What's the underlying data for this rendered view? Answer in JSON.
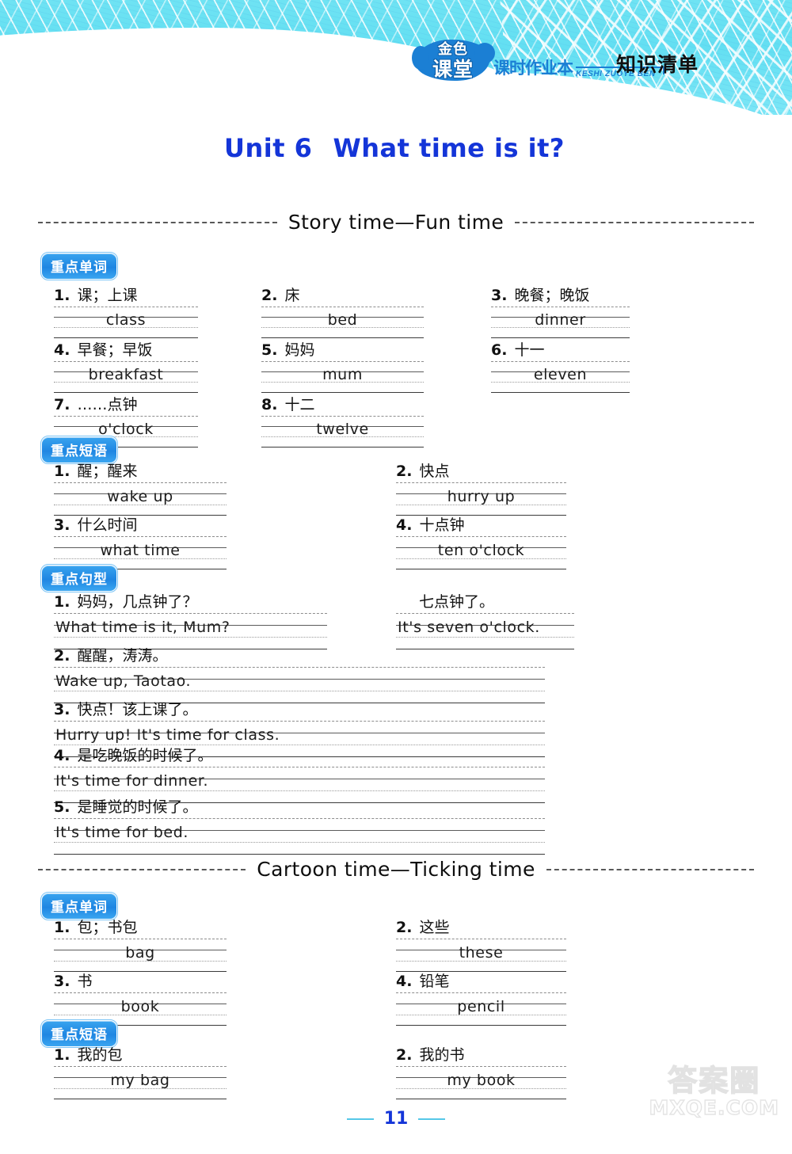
{
  "banner": {
    "logo_line1": "金色",
    "logo_line2": "课堂",
    "logo_sub": "课时作业本",
    "logo_pinyin": "KESHI ZUOYE BEN",
    "title": "知识清单"
  },
  "unit": {
    "number": "Unit 6",
    "topic": "What time is it?"
  },
  "sections": [
    {
      "divider_label": "Story time—Fun time",
      "groups": [
        {
          "badge": "重点单词",
          "layout": "three-col",
          "items": [
            {
              "num": "1.",
              "cn": "课；上课",
              "en": "class"
            },
            {
              "num": "2.",
              "cn": "床",
              "en": "bed"
            },
            {
              "num": "3.",
              "cn": "晚餐；晚饭",
              "en": "dinner"
            },
            {
              "num": "4.",
              "cn": "早餐；早饭",
              "en": "breakfast"
            },
            {
              "num": "5.",
              "cn": "妈妈",
              "en": "mum"
            },
            {
              "num": "6.",
              "cn": "十一",
              "en": "eleven"
            },
            {
              "num": "7.",
              "cn": "……点钟",
              "en": "o'clock"
            },
            {
              "num": "8.",
              "cn": "十二",
              "en": "twelve"
            }
          ]
        },
        {
          "badge": "重点短语",
          "layout": "two-col",
          "items": [
            {
              "num": "1.",
              "cn": "醒；醒来",
              "en": "wake up"
            },
            {
              "num": "2.",
              "cn": "快点",
              "en": "hurry up"
            },
            {
              "num": "3.",
              "cn": "什么时间",
              "en": "what time"
            },
            {
              "num": "4.",
              "cn": "十点钟",
              "en": "ten o'clock"
            }
          ]
        },
        {
          "badge": "重点句型",
          "layout": "sentences",
          "items": [
            {
              "num": "1.",
              "cn": "妈妈，几点钟了？",
              "en": "What time is it, Mum?"
            },
            {
              "num": "",
              "cn": "七点钟了。",
              "en": "It's seven o'clock."
            },
            {
              "num": "2.",
              "cn": "醒醒，涛涛。",
              "en": "Wake up, Taotao."
            },
            {
              "num": "3.",
              "cn": "快点！该上课了。",
              "en": "Hurry up! It's time for class."
            },
            {
              "num": "4.",
              "cn": "是吃晚饭的时候了。",
              "en": "It's time for dinner."
            },
            {
              "num": "5.",
              "cn": "是睡觉的时候了。",
              "en": "It's time for bed."
            }
          ]
        }
      ]
    },
    {
      "divider_label": "Cartoon time—Ticking time",
      "groups": [
        {
          "badge": "重点单词",
          "layout": "two-col",
          "items": [
            {
              "num": "1.",
              "cn": "包；书包",
              "en": "bag"
            },
            {
              "num": "2.",
              "cn": "这些",
              "en": "these"
            },
            {
              "num": "3.",
              "cn": "书",
              "en": "book"
            },
            {
              "num": "4.",
              "cn": "铅笔",
              "en": "pencil"
            }
          ]
        },
        {
          "badge": "重点短语",
          "layout": "two-col",
          "items": [
            {
              "num": "1.",
              "cn": "我的包",
              "en": "my bag"
            },
            {
              "num": "2.",
              "cn": "我的书",
              "en": "my book"
            }
          ]
        }
      ]
    }
  ],
  "footer": {
    "page_number": "11"
  },
  "watermark": {
    "cn": "答案圈",
    "en": "MXQE.COM"
  },
  "colors": {
    "banner": "#6fe3f3",
    "title_blue": "#1435d8",
    "badge_blue": "#1f86e2"
  }
}
